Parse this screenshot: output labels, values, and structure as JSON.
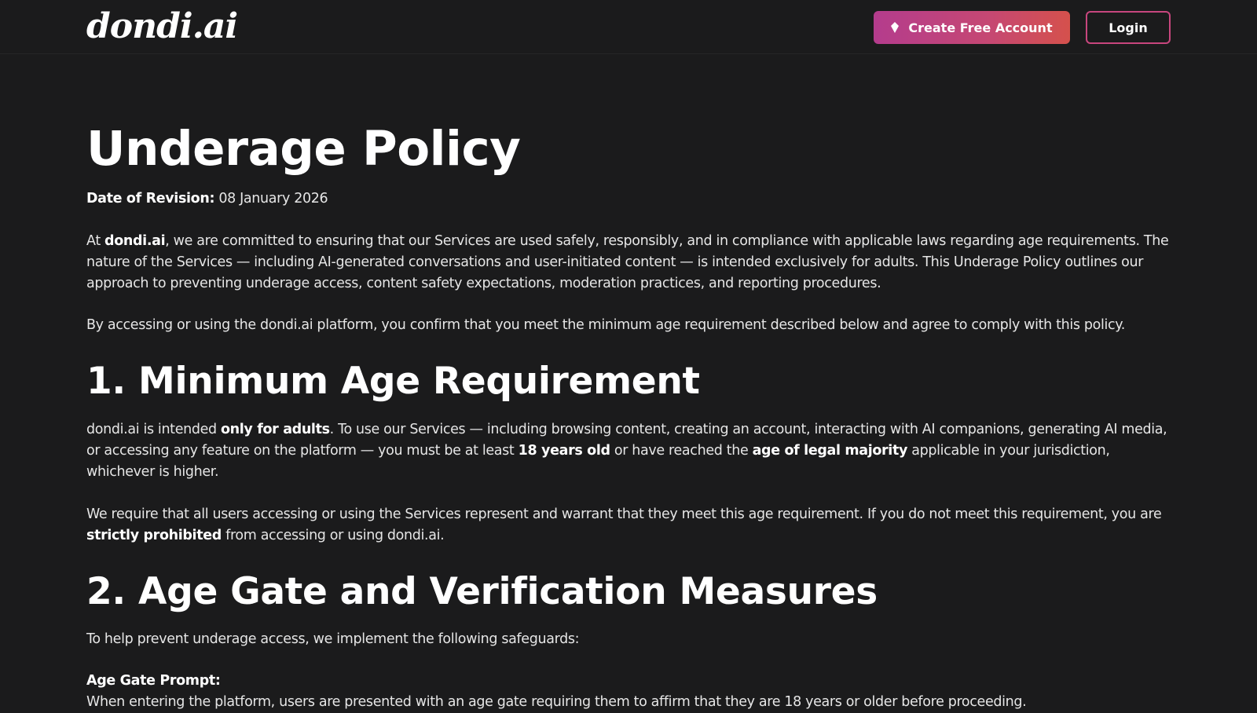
{
  "header": {
    "logo_text": "dondi",
    "logo_suffix": ".ai",
    "create_account_label": "Create Free Account",
    "login_label": "Login",
    "brand_gradient": [
      "#b43c8d",
      "#d5514c"
    ],
    "login_border_color": "#c8467e"
  },
  "page": {
    "title": "Underage Policy",
    "revision_label": "Date of Revision:",
    "revision_date": "08 January 2026",
    "intro_prefix": "At ",
    "intro_brand": "dondi.ai",
    "intro_rest": ", we are committed to ensuring that our Services are used safely, responsibly, and in compliance with applicable laws regarding age requirements. The nature of the Services — including AI-generated conversations and user-initiated content — is intended exclusively for adults. This Underage Policy outlines our approach to preventing underage access, content safety expectations, moderation practices, and reporting procedures.",
    "agree_text": "By accessing or using the dondi.ai platform, you confirm that you meet the minimum age requirement described below and agree to comply with this policy."
  },
  "section1": {
    "heading": "1. Minimum Age Requirement",
    "p1_a": "dondi.ai is intended ",
    "p1_b": "only for adults",
    "p1_c": ". To use our Services — including browsing content, creating an account, interacting with AI companions, generating AI media, or accessing any feature on the platform — you must be at least ",
    "p1_d": "18 years old",
    "p1_e": " or have reached the ",
    "p1_f": "age of legal majority",
    "p1_g": " applicable in your jurisdiction, whichever is higher.",
    "p2_a": "We require that all users accessing or using the Services represent and warrant that they meet this age requirement. If you do not meet this requirement, you are ",
    "p2_b": "strictly prohibited",
    "p2_c": " from accessing or using dondi.ai."
  },
  "section2": {
    "heading": "2. Age Gate and Verification Measures",
    "intro": "To help prevent underage access, we implement the following safeguards:",
    "item_label": "Age Gate Prompt:",
    "item_text": "When entering the platform, users are presented with an age gate requiring them to affirm that they are 18 years or older before proceeding."
  }
}
